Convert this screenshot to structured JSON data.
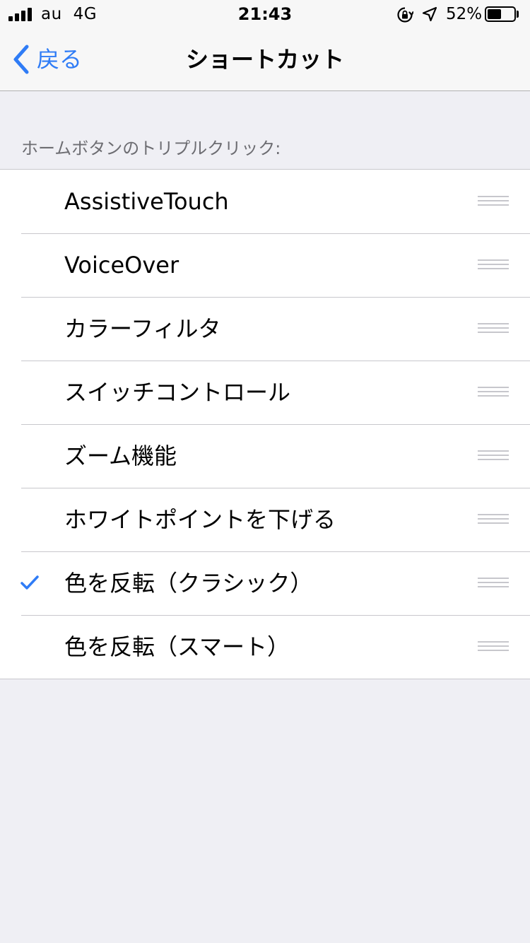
{
  "status_bar": {
    "carrier": "au",
    "network": "4G",
    "time": "21:43",
    "battery_percent": "52%",
    "battery_level": 0.52,
    "icons": [
      "signal-icon",
      "orientation-lock-icon",
      "location-icon",
      "battery-icon"
    ]
  },
  "nav": {
    "back_label": "戻る",
    "title": "ショートカット",
    "accent_color": "#2f7cf6"
  },
  "section": {
    "header": "ホームボタンのトリプルクリック:"
  },
  "items": [
    {
      "label": "AssistiveTouch",
      "checked": false
    },
    {
      "label": "VoiceOver",
      "checked": false
    },
    {
      "label": "カラーフィルタ",
      "checked": false
    },
    {
      "label": "スイッチコントロール",
      "checked": false
    },
    {
      "label": "ズーム機能",
      "checked": false
    },
    {
      "label": "ホワイトポイントを下げる",
      "checked": false
    },
    {
      "label": "色を反転（クラシック）",
      "checked": true
    },
    {
      "label": "色を反転（スマート）",
      "checked": false
    }
  ]
}
